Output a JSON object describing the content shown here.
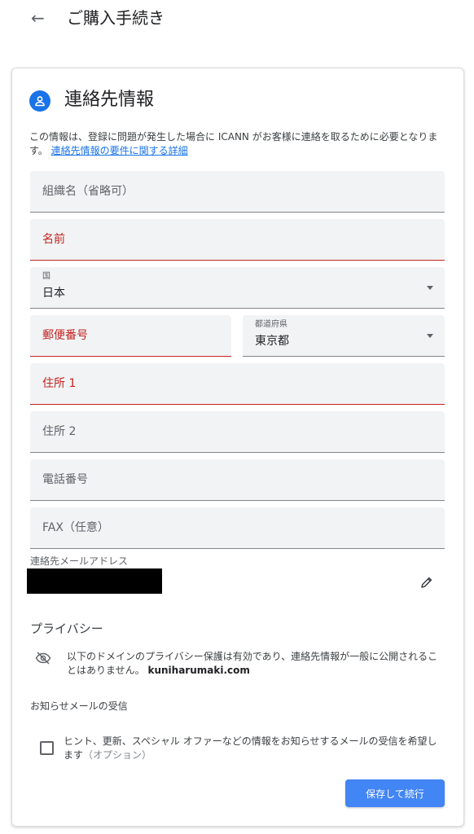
{
  "header": {
    "back_icon": "arrow-left-icon",
    "title": "ご購入手続き"
  },
  "card": {
    "title": "連絡先情報",
    "intro_text": "この情報は、登録に問題が発生した場合に ICANN がお客様に連絡を取るために必要となります。",
    "intro_link": "連絡先情報の要件に関する詳細",
    "fields": {
      "organization": {
        "placeholder": "組織名（省略可）"
      },
      "name": {
        "placeholder": "名前"
      },
      "country": {
        "label": "国",
        "value": "日本"
      },
      "postal_code": {
        "placeholder": "郵便番号"
      },
      "prefecture": {
        "label": "都道府県",
        "value": "東京都"
      },
      "address1": {
        "placeholder": "住所 1"
      },
      "address2": {
        "placeholder": "住所 2"
      },
      "phone": {
        "placeholder": "電話番号"
      },
      "fax": {
        "placeholder": "FAX（任意）"
      }
    },
    "email": {
      "label": "連絡先メールアドレス",
      "edit_icon": "pencil-icon"
    },
    "privacy": {
      "title": "プライバシー",
      "icon": "eye-off-icon",
      "text": "以下のドメインのプライバシー保護は有効であり、連絡先情報が一般に公開されることはありません。",
      "domain": "kuniharumaki.com"
    },
    "newsletter": {
      "title": "お知らせメールの受信",
      "checkbox_text": "ヒント、更新、スペシャル オファーなどの情報をお知らせするメールの受信を希望します",
      "optional": "（オプション）",
      "checked": false
    },
    "save_button": "保存して続行"
  },
  "colors": {
    "accent": "#1a73e8",
    "button": "#4285f4",
    "error": "#c5221f",
    "field_bg": "#f1f3f4"
  }
}
